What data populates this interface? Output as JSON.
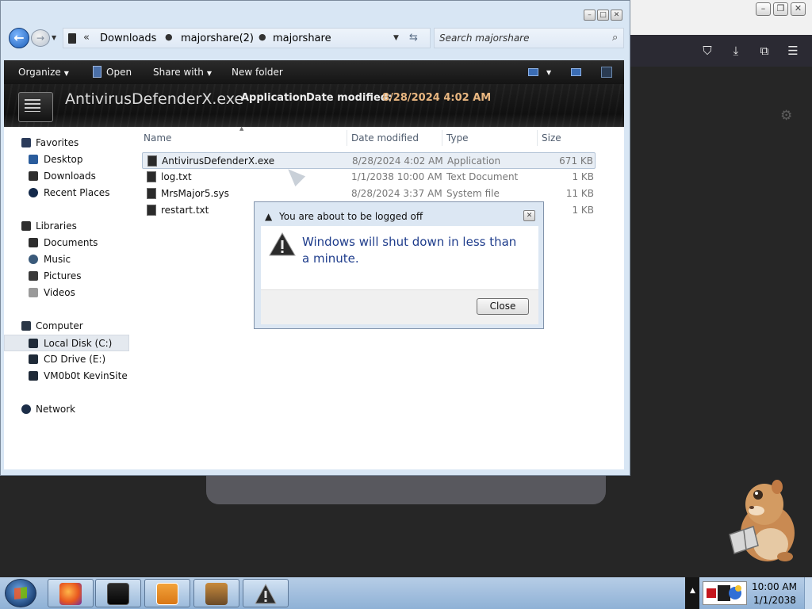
{
  "explorer": {
    "breadcrumb": [
      "Downloads",
      "majorshare(2)",
      "majorshare"
    ],
    "search_placeholder": "Search majorshare",
    "commands": {
      "organize": "Organize",
      "open": "Open",
      "share_with": "Share with",
      "new_folder": "New folder"
    },
    "details": {
      "name": "AntivirusDefenderX.exe",
      "type": "Application",
      "date_label": "Date modified:",
      "date_value": "8/28/2024 4:02 AM"
    },
    "nav": {
      "favorites": "Favorites",
      "desktop": "Desktop",
      "downloads": "Downloads",
      "recent_places": "Recent Places",
      "libraries": "Libraries",
      "documents": "Documents",
      "music": "Music",
      "pictures": "Pictures",
      "videos": "Videos",
      "computer": "Computer",
      "local_disk": "Local Disk (C:)",
      "cd_drive": "CD Drive (E:)",
      "vm_drive": "VM0b0t KevinSite",
      "network": "Network"
    },
    "columns": {
      "name": "Name",
      "date": "Date modified",
      "type": "Type",
      "size": "Size"
    },
    "files": [
      {
        "name": "AntivirusDefenderX.exe",
        "date": "8/28/2024 4:02 AM",
        "type": "Application",
        "size": "671 KB"
      },
      {
        "name": "log.txt",
        "date": "1/1/2038 10:00 AM",
        "type": "Text Document",
        "size": "1 KB"
      },
      {
        "name": "MrsMajor5.sys",
        "date": "8/28/2024 3:37 AM",
        "type": "System file",
        "size": "11 KB"
      },
      {
        "name": "restart.txt",
        "date": "",
        "type": "",
        "size": "1 KB"
      }
    ]
  },
  "dialog": {
    "title": "You are about to be logged off",
    "message": "Windows will shut down in less than a minute.",
    "close_button": "Close"
  },
  "taskbar": {
    "time": "10:00 AM",
    "date": "1/1/2038",
    "pinned_icons": [
      "firefox-icon",
      "terminal-icon",
      "media-player-icon",
      "bonzi-box-icon",
      "warning-app-icon"
    ]
  },
  "colors": {
    "dialog_message": "#1f3d8c",
    "details_date": "#e8b680",
    "window_frame": "#d8e6f4"
  }
}
